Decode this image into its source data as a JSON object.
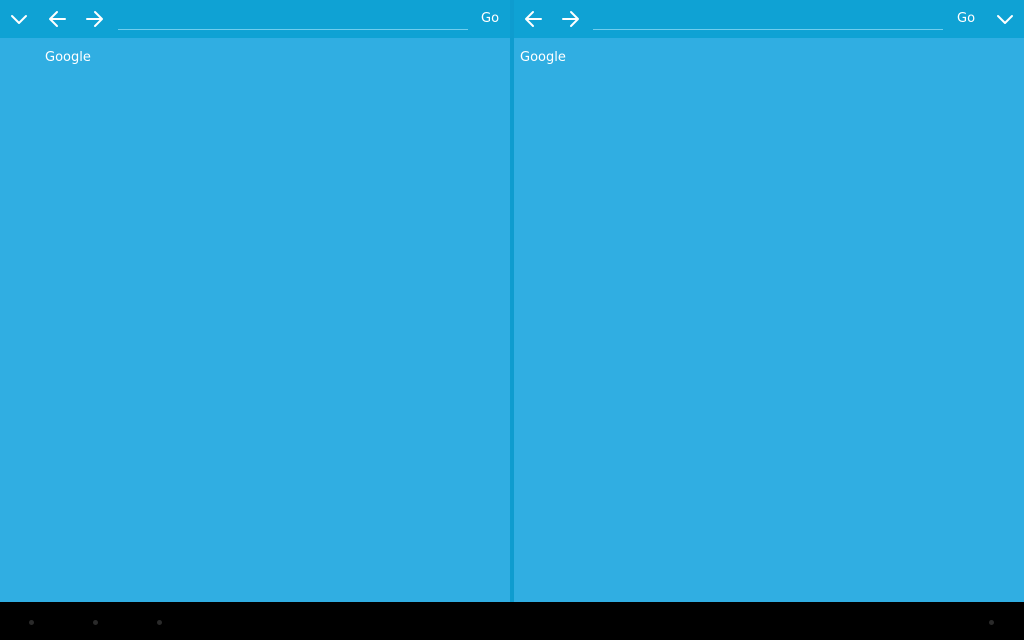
{
  "colors": {
    "pane_background": "#30aee2",
    "toolbar_background": "#0fa2d4",
    "divider": "#0e9ccf",
    "navigation_bar": "#000000",
    "text": "#ffffff"
  },
  "left_pane": {
    "toolbar": {
      "menu_icon": "chevron-down-icon",
      "back_icon": "arrow-left-icon",
      "forward_icon": "arrow-right-icon",
      "url_value": "",
      "url_placeholder": "",
      "go_label": "Go"
    },
    "page": {
      "link_text": "Google"
    }
  },
  "right_pane": {
    "toolbar": {
      "back_icon": "arrow-left-icon",
      "forward_icon": "arrow-right-icon",
      "url_value": "",
      "url_placeholder": "",
      "go_label": "Go",
      "menu_icon": "chevron-down-icon"
    },
    "page": {
      "link_text": "Google"
    }
  },
  "navigation_bar": {
    "buttons": [
      "back",
      "home",
      "recent-apps",
      "menu"
    ]
  }
}
